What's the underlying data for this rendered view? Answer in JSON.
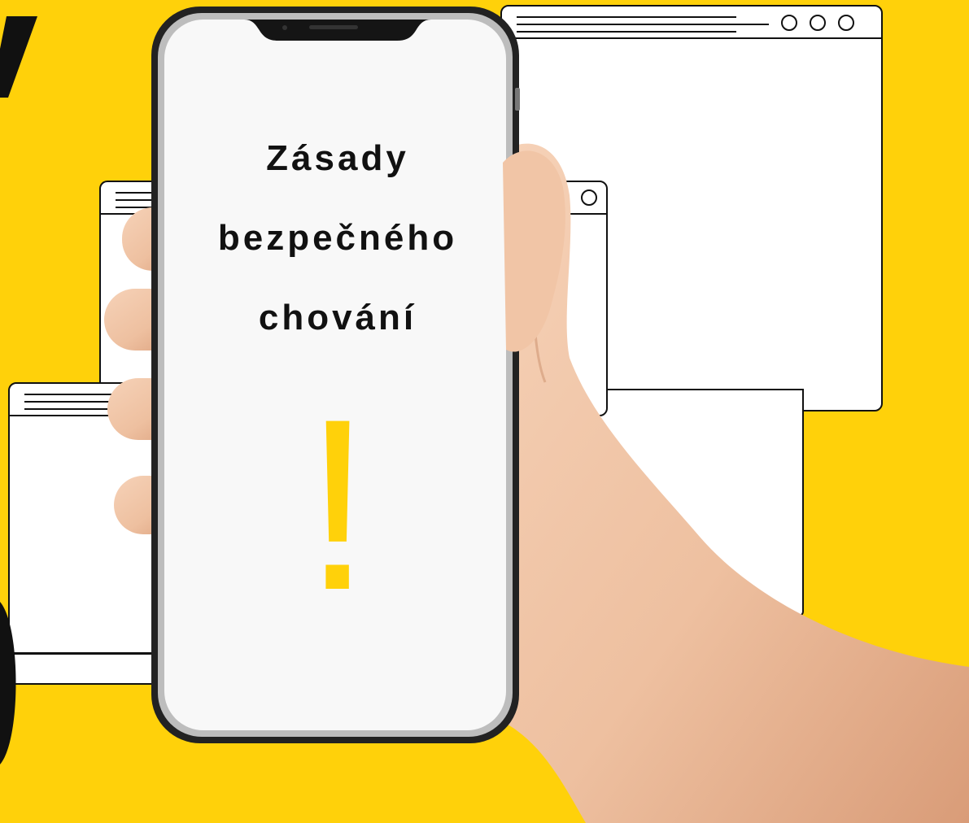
{
  "colors": {
    "background": "#FFD10A",
    "accent": "#FFD10A",
    "window_fill": "#FFFFFF",
    "outline": "#111111",
    "phone_screen": "#F8F8F8",
    "skin": "#F2C6A8"
  },
  "phone": {
    "heading_lines": [
      "Zásady",
      "bezpečného",
      "chování"
    ],
    "mark": "!"
  },
  "icons": [
    "browser-window",
    "smartphone",
    "hand"
  ]
}
